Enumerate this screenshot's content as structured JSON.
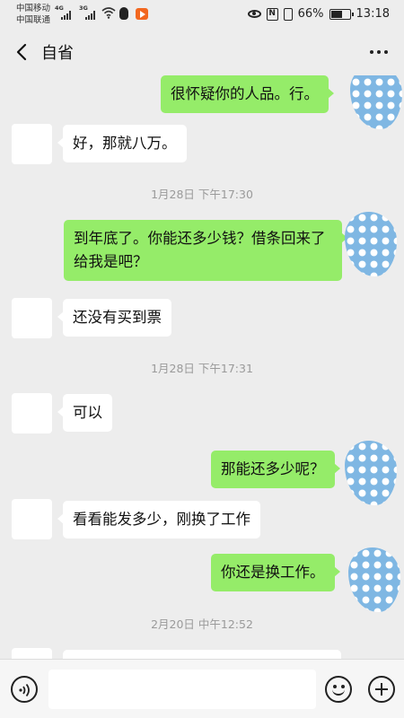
{
  "status_bar": {
    "carrier1": "中国移动",
    "carrier2": "中国联通",
    "net1": "4G",
    "net2": "3G",
    "battery_text": "66%",
    "battery_level": 0.66,
    "time": "13:18",
    "icons": [
      "signal-icon",
      "wifi-icon",
      "qq-icon",
      "app-icon",
      "eye-icon",
      "nfc-icon",
      "vibrate-icon",
      "battery-icon"
    ]
  },
  "header": {
    "title": "自省",
    "back_icon": "chevron-left-icon",
    "more_icon": "more-icon"
  },
  "messages": [
    {
      "side": "right",
      "text": "很怀疑你的人品。行。"
    },
    {
      "side": "left",
      "text": "好，那就八万。"
    },
    {
      "type": "time",
      "text": "1月28日 下午17:30"
    },
    {
      "side": "right",
      "text": "到年底了。你能还多少钱？借条回来了给我是吧？"
    },
    {
      "side": "left",
      "text": "还没有买到票"
    },
    {
      "type": "time",
      "text": "1月28日 下午17:31"
    },
    {
      "side": "left",
      "text": "可以"
    },
    {
      "side": "right",
      "text": "那能还多少呢？"
    },
    {
      "side": "left",
      "text": "看看能发多少，刚换了工作"
    },
    {
      "side": "right",
      "text": "你还是换工作。"
    },
    {
      "type": "time",
      "text": "2月20日 中午12:52"
    }
  ],
  "input": {
    "value": "",
    "placeholder": ""
  },
  "colors": {
    "background": "#ededed",
    "my_bubble": "#95ec69",
    "their_bubble": "#ffffff",
    "avatar": "#7fb7e3"
  }
}
